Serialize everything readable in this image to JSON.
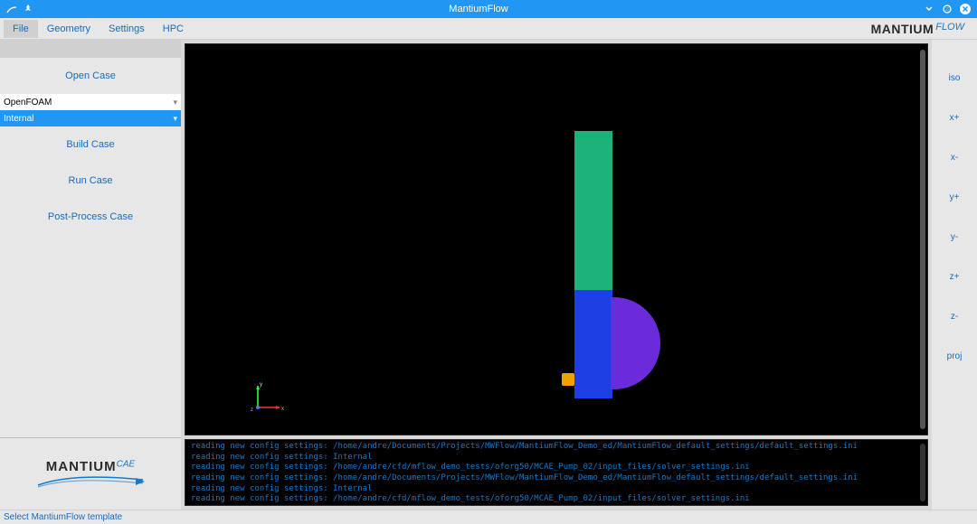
{
  "window": {
    "title": "MantiumFlow"
  },
  "menubar": {
    "items": [
      "File",
      "Geometry",
      "Settings",
      "HPC"
    ],
    "active_index": 0,
    "brand_main": "MANTIUM",
    "brand_sup": "FLOW"
  },
  "sidebar": {
    "buttons": [
      "Open Case",
      "Build Case",
      "Run Case",
      "Post-Process Case"
    ],
    "select1": {
      "value": "OpenFOAM"
    },
    "select2": {
      "value": "Internal"
    },
    "logo_main": "MANTIUM",
    "logo_sup": "CAE"
  },
  "viewport": {
    "axis_labels": {
      "x": "x",
      "y": "y",
      "z": "z"
    },
    "colors": {
      "block_top": "#1cb27a",
      "block_mid": "#1e3fe3",
      "disc": "#6b2bd9",
      "stub": "#f2a100"
    }
  },
  "rightbar": {
    "views": [
      "iso",
      "x+",
      "x-",
      "y+",
      "y-",
      "z+",
      "z-",
      "proj"
    ]
  },
  "console": {
    "lines": [
      "reading new config settings: /home/andre/Documents/Projects/MWFlow/MantiumFlow_Demo_ed/MantiumFlow_default_settings/default_settings.ini",
      "reading new config settings: Internal",
      "reading new config settings: /home/andre/cfd/mflow_demo_tests/oforg50/MCAE_Pump_02/input_files/solver_settings.ini",
      "reading new config settings: /home/andre/Documents/Projects/MWFlow/MantiumFlow_Demo_ed/MantiumFlow_default_settings/default_settings.ini",
      "reading new config settings: Internal",
      "reading new config settings: /home/andre/cfd/mflow_demo_tests/oforg50/MCAE_Pump_02/input_files/solver_settings.ini"
    ]
  },
  "statusbar": {
    "text": "Select MantiumFlow template"
  }
}
